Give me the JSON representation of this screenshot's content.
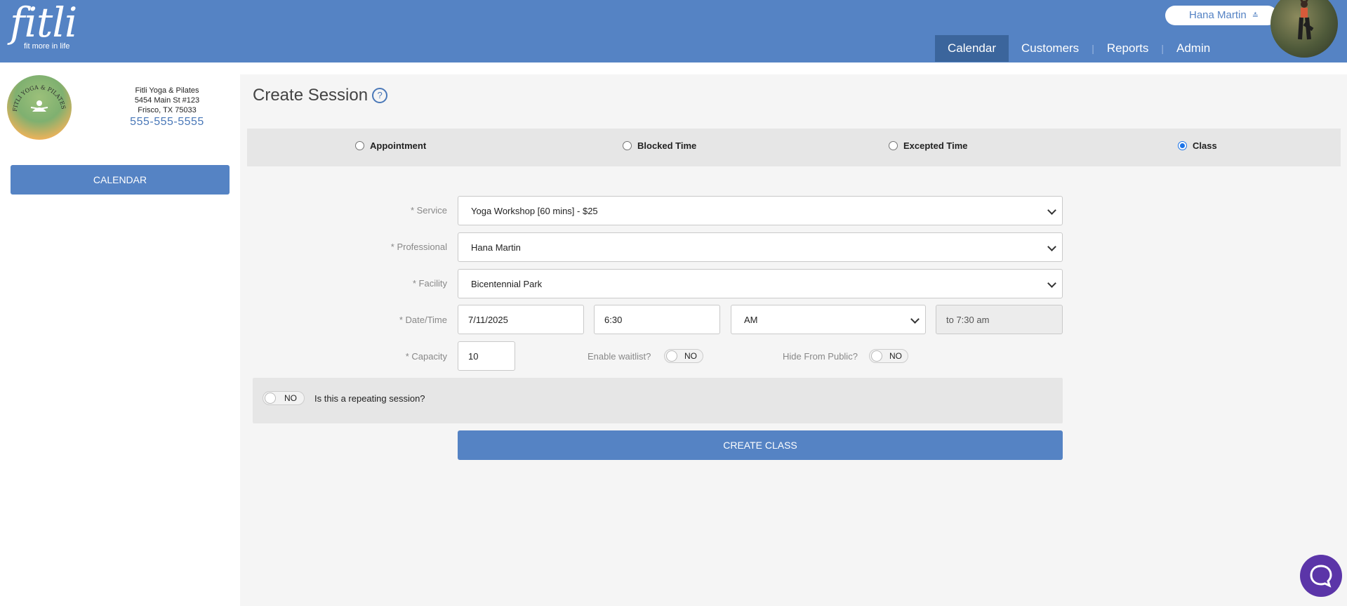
{
  "brand": {
    "logo_text": "fitli",
    "tagline": "fit more in life"
  },
  "user": {
    "name": "Hana Martin"
  },
  "nav": {
    "items": [
      "Calendar",
      "Customers",
      "Reports",
      "Admin"
    ]
  },
  "business": {
    "name": "Fitli Yoga & Pilates",
    "address1": "5454 Main St #123",
    "address2": "Frisco, TX 75033",
    "phone": "555-555-5555",
    "logo_text": "FITLI YOGA & PILATES"
  },
  "sidebar": {
    "calendar_button": "CALENDAR"
  },
  "page": {
    "title": "Create Session"
  },
  "session_types": [
    {
      "label": "Appointment",
      "selected": false
    },
    {
      "label": "Blocked Time",
      "selected": false
    },
    {
      "label": "Excepted Time",
      "selected": false
    },
    {
      "label": "Class",
      "selected": true
    }
  ],
  "form": {
    "service": {
      "label": "* Service",
      "value": "Yoga Workshop [60 mins] - $25"
    },
    "professional": {
      "label": "* Professional",
      "value": "Hana Martin"
    },
    "facility": {
      "label": "* Facility",
      "value": "Bicentennial Park"
    },
    "datetime": {
      "label": "* Date/Time",
      "date": "7/11/2025",
      "time": "6:30",
      "ampm": "AM",
      "end": "to 7:30 am"
    },
    "capacity": {
      "label": "* Capacity",
      "value": "10"
    },
    "waitlist": {
      "label": "Enable waitlist?",
      "state": "NO"
    },
    "hide_public": {
      "label": "Hide From Public?",
      "state": "NO"
    },
    "repeating": {
      "label": "Is this a repeating session?",
      "state": "NO"
    }
  },
  "actions": {
    "create": "CREATE CLASS"
  }
}
